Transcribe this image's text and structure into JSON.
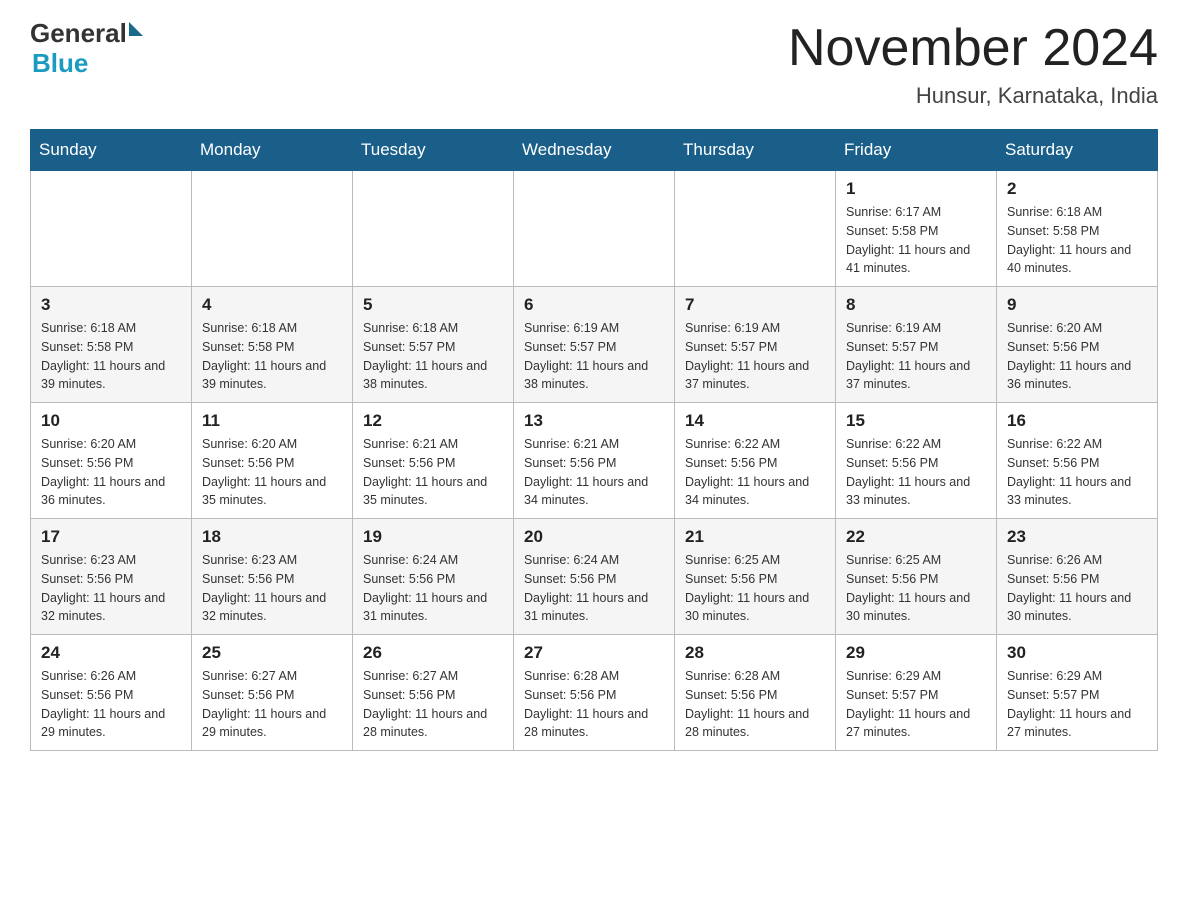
{
  "header": {
    "logo_general": "General",
    "logo_blue": "Blue",
    "month_title": "November 2024",
    "location": "Hunsur, Karnataka, India"
  },
  "weekdays": [
    "Sunday",
    "Monday",
    "Tuesday",
    "Wednesday",
    "Thursday",
    "Friday",
    "Saturday"
  ],
  "weeks": [
    {
      "days": [
        {
          "number": "",
          "info": ""
        },
        {
          "number": "",
          "info": ""
        },
        {
          "number": "",
          "info": ""
        },
        {
          "number": "",
          "info": ""
        },
        {
          "number": "",
          "info": ""
        },
        {
          "number": "1",
          "info": "Sunrise: 6:17 AM\nSunset: 5:58 PM\nDaylight: 11 hours and 41 minutes."
        },
        {
          "number": "2",
          "info": "Sunrise: 6:18 AM\nSunset: 5:58 PM\nDaylight: 11 hours and 40 minutes."
        }
      ]
    },
    {
      "days": [
        {
          "number": "3",
          "info": "Sunrise: 6:18 AM\nSunset: 5:58 PM\nDaylight: 11 hours and 39 minutes."
        },
        {
          "number": "4",
          "info": "Sunrise: 6:18 AM\nSunset: 5:58 PM\nDaylight: 11 hours and 39 minutes."
        },
        {
          "number": "5",
          "info": "Sunrise: 6:18 AM\nSunset: 5:57 PM\nDaylight: 11 hours and 38 minutes."
        },
        {
          "number": "6",
          "info": "Sunrise: 6:19 AM\nSunset: 5:57 PM\nDaylight: 11 hours and 38 minutes."
        },
        {
          "number": "7",
          "info": "Sunrise: 6:19 AM\nSunset: 5:57 PM\nDaylight: 11 hours and 37 minutes."
        },
        {
          "number": "8",
          "info": "Sunrise: 6:19 AM\nSunset: 5:57 PM\nDaylight: 11 hours and 37 minutes."
        },
        {
          "number": "9",
          "info": "Sunrise: 6:20 AM\nSunset: 5:56 PM\nDaylight: 11 hours and 36 minutes."
        }
      ]
    },
    {
      "days": [
        {
          "number": "10",
          "info": "Sunrise: 6:20 AM\nSunset: 5:56 PM\nDaylight: 11 hours and 36 minutes."
        },
        {
          "number": "11",
          "info": "Sunrise: 6:20 AM\nSunset: 5:56 PM\nDaylight: 11 hours and 35 minutes."
        },
        {
          "number": "12",
          "info": "Sunrise: 6:21 AM\nSunset: 5:56 PM\nDaylight: 11 hours and 35 minutes."
        },
        {
          "number": "13",
          "info": "Sunrise: 6:21 AM\nSunset: 5:56 PM\nDaylight: 11 hours and 34 minutes."
        },
        {
          "number": "14",
          "info": "Sunrise: 6:22 AM\nSunset: 5:56 PM\nDaylight: 11 hours and 34 minutes."
        },
        {
          "number": "15",
          "info": "Sunrise: 6:22 AM\nSunset: 5:56 PM\nDaylight: 11 hours and 33 minutes."
        },
        {
          "number": "16",
          "info": "Sunrise: 6:22 AM\nSunset: 5:56 PM\nDaylight: 11 hours and 33 minutes."
        }
      ]
    },
    {
      "days": [
        {
          "number": "17",
          "info": "Sunrise: 6:23 AM\nSunset: 5:56 PM\nDaylight: 11 hours and 32 minutes."
        },
        {
          "number": "18",
          "info": "Sunrise: 6:23 AM\nSunset: 5:56 PM\nDaylight: 11 hours and 32 minutes."
        },
        {
          "number": "19",
          "info": "Sunrise: 6:24 AM\nSunset: 5:56 PM\nDaylight: 11 hours and 31 minutes."
        },
        {
          "number": "20",
          "info": "Sunrise: 6:24 AM\nSunset: 5:56 PM\nDaylight: 11 hours and 31 minutes."
        },
        {
          "number": "21",
          "info": "Sunrise: 6:25 AM\nSunset: 5:56 PM\nDaylight: 11 hours and 30 minutes."
        },
        {
          "number": "22",
          "info": "Sunrise: 6:25 AM\nSunset: 5:56 PM\nDaylight: 11 hours and 30 minutes."
        },
        {
          "number": "23",
          "info": "Sunrise: 6:26 AM\nSunset: 5:56 PM\nDaylight: 11 hours and 30 minutes."
        }
      ]
    },
    {
      "days": [
        {
          "number": "24",
          "info": "Sunrise: 6:26 AM\nSunset: 5:56 PM\nDaylight: 11 hours and 29 minutes."
        },
        {
          "number": "25",
          "info": "Sunrise: 6:27 AM\nSunset: 5:56 PM\nDaylight: 11 hours and 29 minutes."
        },
        {
          "number": "26",
          "info": "Sunrise: 6:27 AM\nSunset: 5:56 PM\nDaylight: 11 hours and 28 minutes."
        },
        {
          "number": "27",
          "info": "Sunrise: 6:28 AM\nSunset: 5:56 PM\nDaylight: 11 hours and 28 minutes."
        },
        {
          "number": "28",
          "info": "Sunrise: 6:28 AM\nSunset: 5:56 PM\nDaylight: 11 hours and 28 minutes."
        },
        {
          "number": "29",
          "info": "Sunrise: 6:29 AM\nSunset: 5:57 PM\nDaylight: 11 hours and 27 minutes."
        },
        {
          "number": "30",
          "info": "Sunrise: 6:29 AM\nSunset: 5:57 PM\nDaylight: 11 hours and 27 minutes."
        }
      ]
    }
  ]
}
